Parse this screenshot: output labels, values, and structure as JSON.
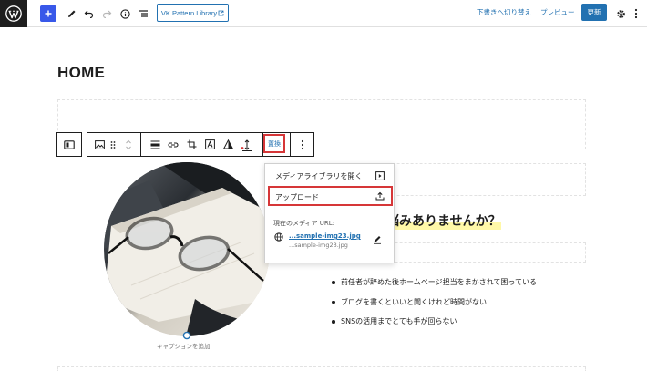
{
  "topbar": {
    "logo": "wordpress-logo",
    "add_icon": "plus-icon",
    "tools_icon": "pencil-icon",
    "undo_icon": "undo-icon",
    "redo_icon": "redo-icon",
    "details_icon": "info-icon",
    "list_view_icon": "list-view-icon",
    "pattern_library_label": "VK Pattern Library",
    "switch_draft_label": "下書きへ切り替え",
    "preview_label": "プレビュー",
    "update_label": "更新",
    "settings_icon": "gear-icon",
    "options_icon": "more-vertical-icon"
  },
  "canvas": {
    "page_title": "HOME",
    "heading": "悩みありませんか？",
    "list_items": [
      "前任者が辞めた後ホームページ担当をまかされて困っている",
      "ブログを書くといいと聞くけれど時間がない",
      "SNSの活用までとても手が回らない"
    ],
    "caption_placeholder": "キャプションを追加"
  },
  "block_toolbar": {
    "replace_label": "置換"
  },
  "replace_popover": {
    "open_media_library": "メディアライブラリを開く",
    "upload": "アップロード",
    "current_media_url_label": "現在のメディア URL:",
    "url_link": "...sample-img23.jpg",
    "url_text": "...sample-img23.jpg"
  },
  "colors": {
    "accent": "#2271b1",
    "highlight_border": "#d63638",
    "heading_marker": "#fff8a8"
  }
}
